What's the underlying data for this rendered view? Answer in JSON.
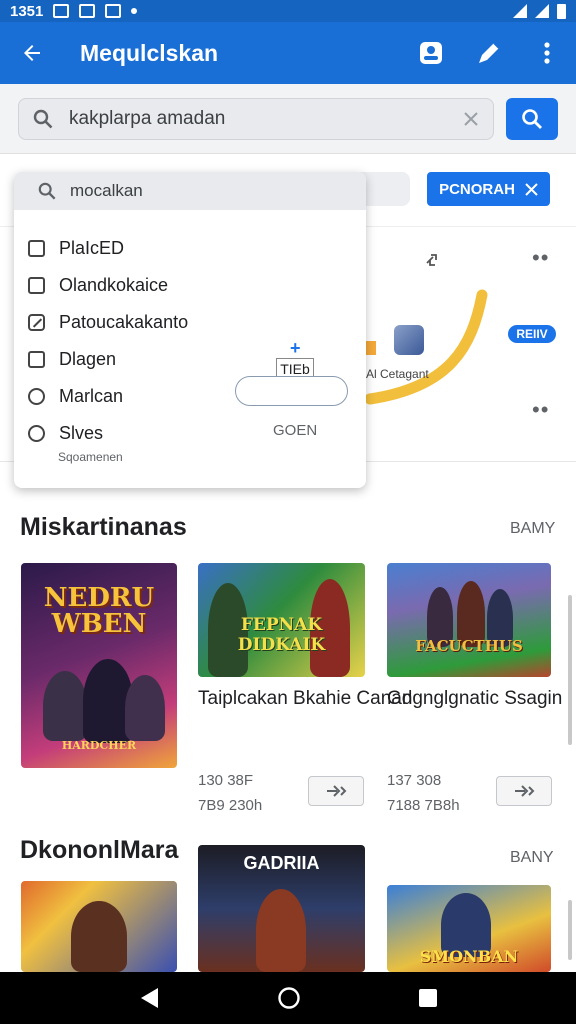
{
  "status_bar": {
    "time": "1351"
  },
  "app_bar": {
    "title": "Mequlclskan"
  },
  "search": {
    "value": "kakplarpa amadan"
  },
  "filter": {
    "chip_label": "PCNORAH"
  },
  "dropdown": {
    "search_value": "mocalkan",
    "items": [
      {
        "label": "PlaIcED",
        "state": "unchecked"
      },
      {
        "label": "Olandkokaice",
        "state": "unchecked"
      },
      {
        "label": "Patoucakakanto",
        "state": "partial"
      },
      {
        "label": "Dlagen",
        "state": "unchecked"
      },
      {
        "label": "Marlcan",
        "state": "round"
      },
      {
        "label": "Slves",
        "state": "round"
      }
    ],
    "subtext": "Sqoamenen",
    "field_label": "TIEb",
    "ok_label": "GOEN"
  },
  "background_card": {
    "caption": "Al Cetagant",
    "badge": "REIIV"
  },
  "sections": [
    {
      "title": "Miskartinanas",
      "more": "BAMY",
      "games": [
        {
          "art_title": "NEDRU WBEN",
          "art_subtitle": "HARDCHER",
          "colors": [
            "#2b1a4a",
            "#c33d7a",
            "#f0a53a"
          ]
        },
        {
          "art_title": "FEPNAK DIDKAIK",
          "name": "Taiplcakan Bkahie Canan",
          "stats": [
            "130 38F",
            "7B9 230h"
          ],
          "colors": [
            "#2e8b3e",
            "#e8d24a",
            "#3a6fc4"
          ]
        },
        {
          "art_title": "FACUCTHUS",
          "name": "Gdgnglgnatic Ssagin",
          "stats": [
            "137 308",
            "7188 7B8h"
          ],
          "colors": [
            "#4a7fd0",
            "#2e9b3a",
            "#b6452c"
          ]
        }
      ]
    },
    {
      "title": "DkononlMara",
      "more": "BANY",
      "games": [
        {
          "art_title": "",
          "colors": [
            "#e06a2c",
            "#3a4fb0",
            "#f0c040"
          ]
        },
        {
          "art_title": "GADRIIA",
          "colors": [
            "#1c1c24",
            "#6a3020",
            "#2e3e6a"
          ]
        },
        {
          "art_title": "SMONBAN",
          "colors": [
            "#3a7fd8",
            "#e8c040",
            "#d04a2a"
          ]
        }
      ]
    }
  ]
}
